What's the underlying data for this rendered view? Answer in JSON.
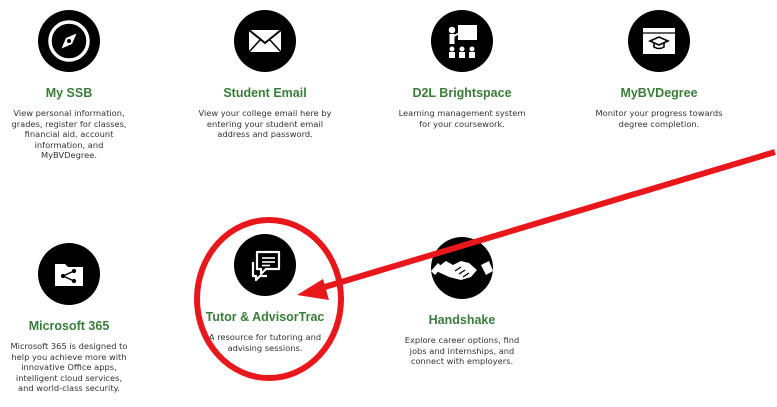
{
  "tiles": [
    {
      "title": "My SSB",
      "description": "View personal information, grades, register for classes, financial aid, account information, and MyBVDegree.",
      "icon": "compass-icon"
    },
    {
      "title": "Student Email",
      "description": "View your college email here by entering your student email address and password.",
      "icon": "envelope-icon"
    },
    {
      "title": "D2L Brightspace",
      "description": "Learning management system for your coursework.",
      "icon": "classroom-presenter-icon"
    },
    {
      "title": "MyBVDegree",
      "description": "Monitor your progress towards degree completion.",
      "icon": "graduation-cap-window-icon"
    },
    {
      "title": "Microsoft 365",
      "description": "Microsoft 365 is designed to help you achieve more with innovative Office apps, intelligent cloud services, and world-class security.",
      "icon": "shared-folder-icon"
    },
    {
      "title": "Tutor & AdvisorTrac",
      "description": "A resource for tutoring and advising sessions.",
      "icon": "chat-bubbles-icon"
    },
    {
      "title": "Handshake",
      "description": "Explore career options, find jobs and internships, and connect with employers.",
      "icon": "handshake-icon"
    }
  ],
  "annotation": {
    "color": "#e8171b",
    "shapes": [
      "circle",
      "arrow"
    ]
  },
  "colors": {
    "title_green": "#3a7d3a",
    "icon_black": "#000000"
  }
}
